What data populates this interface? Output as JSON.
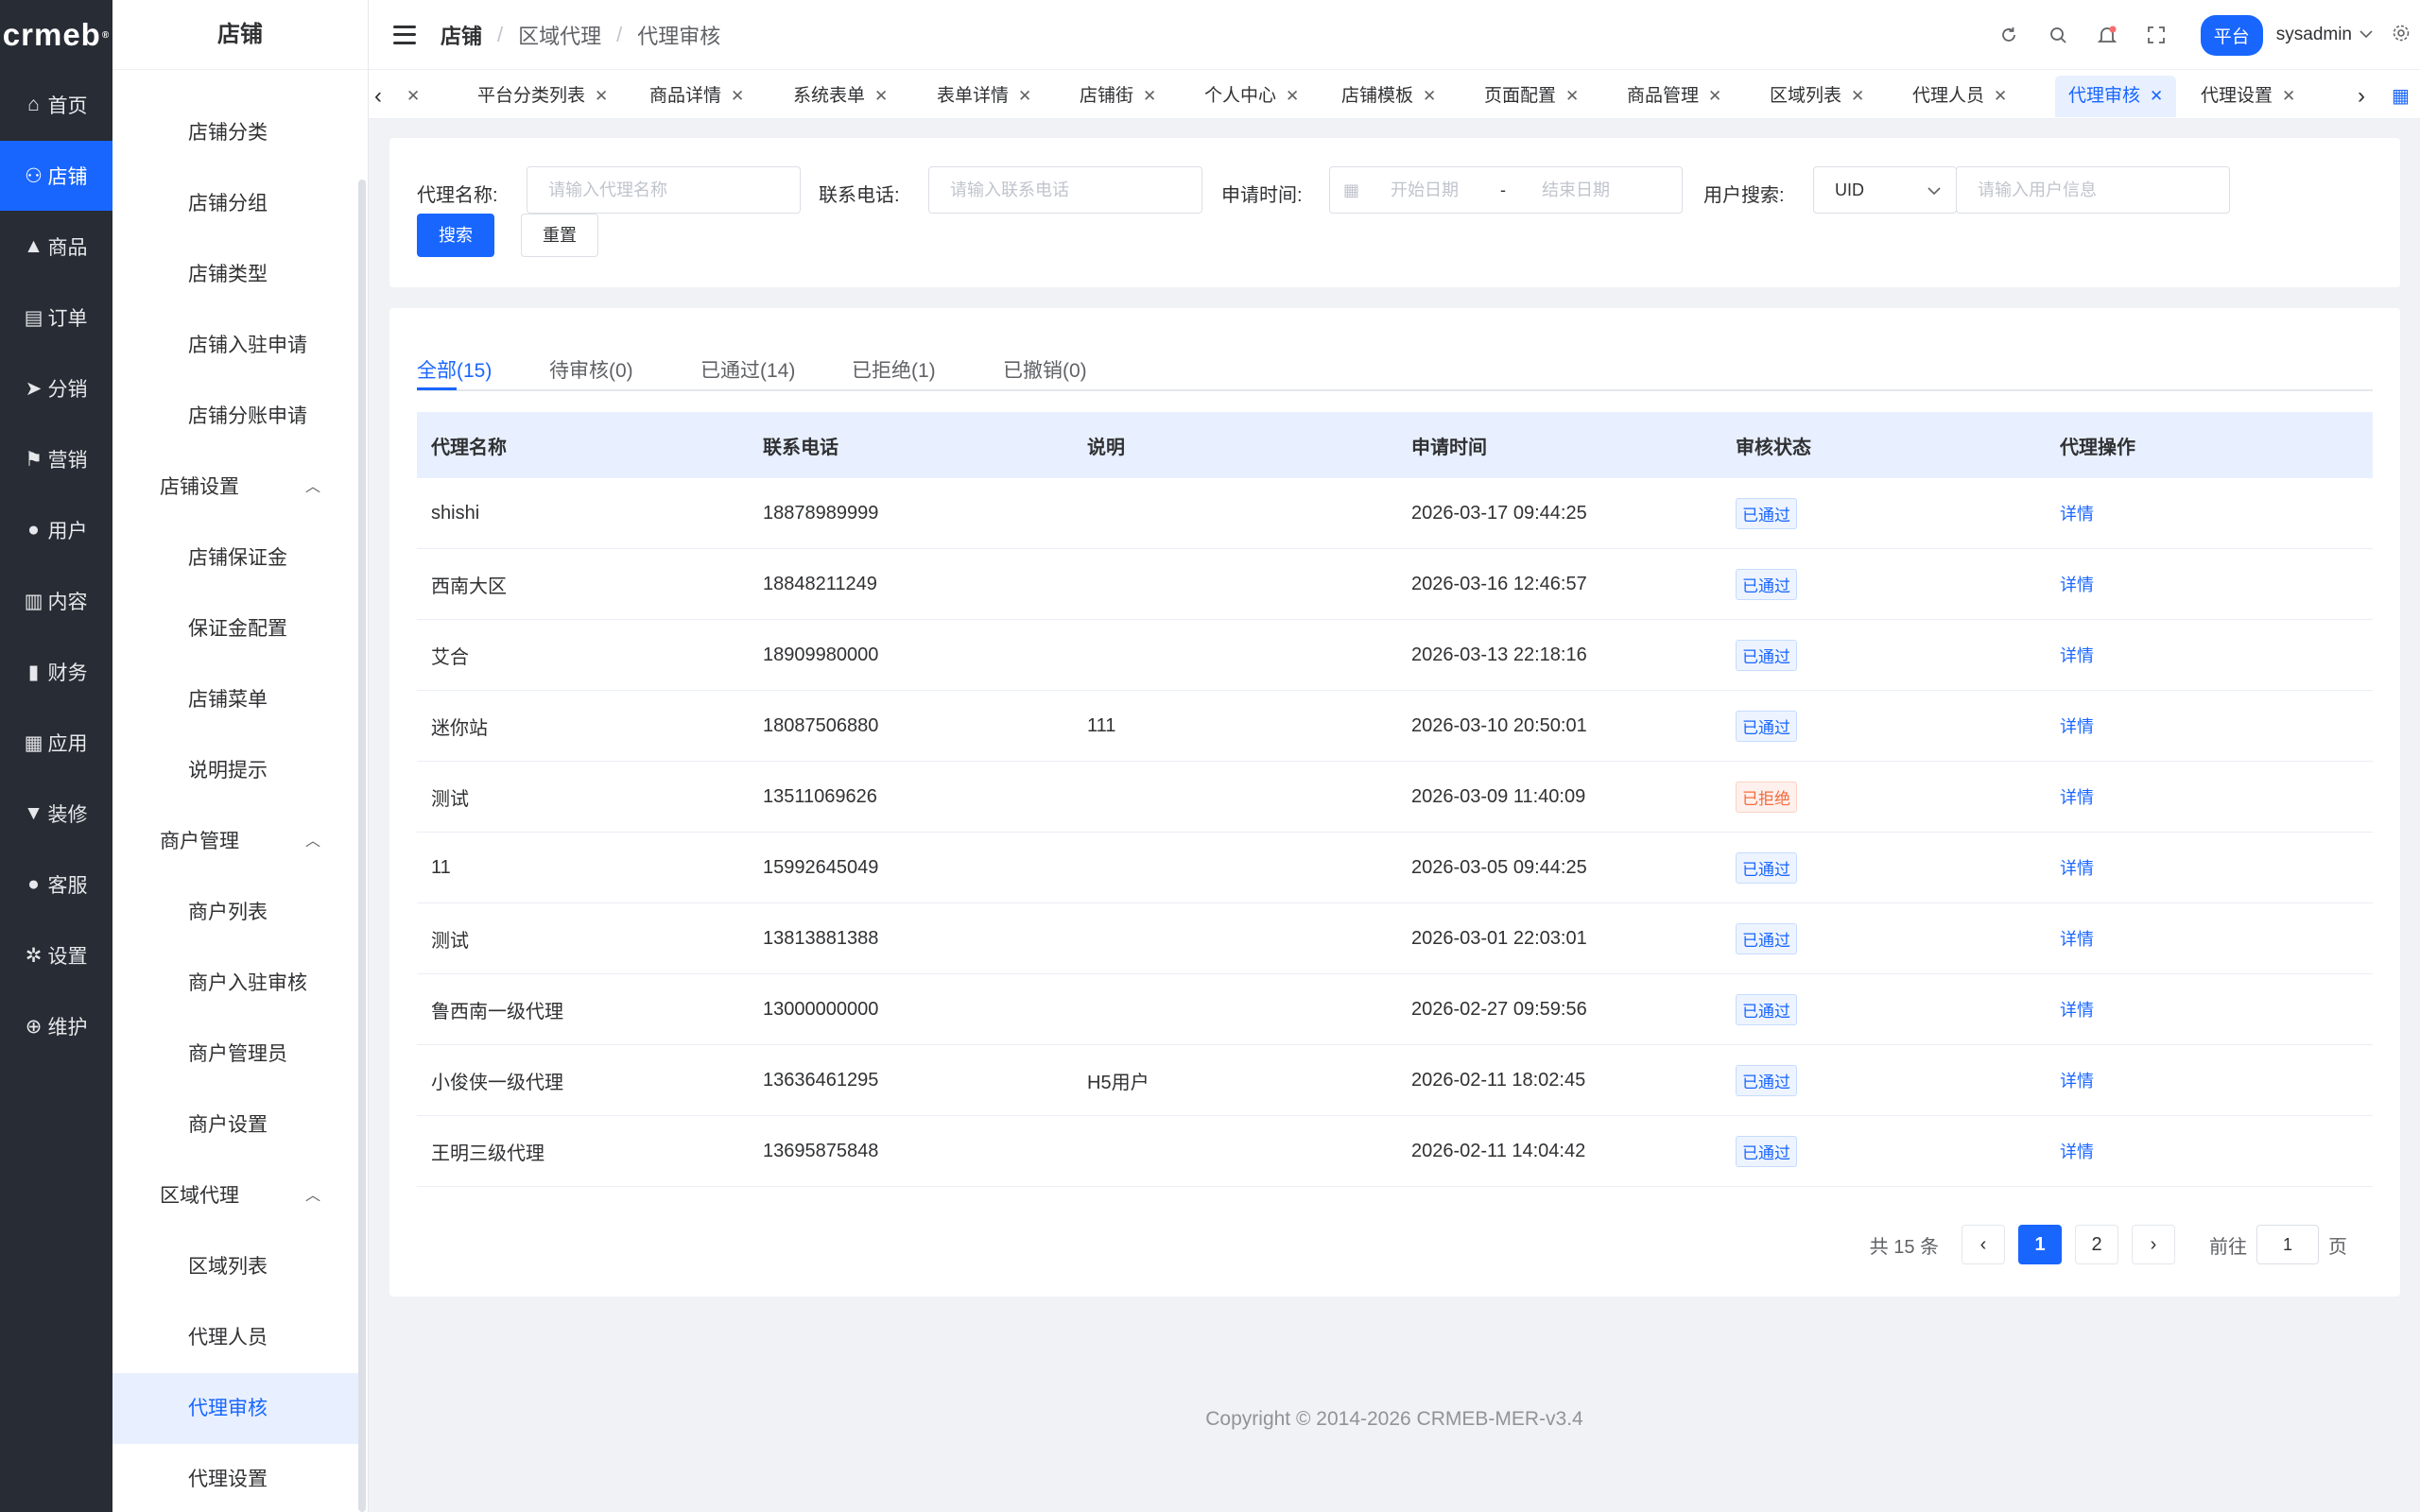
{
  "brand": {
    "logo_text": "crmeb",
    "logo_mark": "®"
  },
  "rail": [
    {
      "label": "首页",
      "icon": "home-icon"
    },
    {
      "label": "店铺",
      "icon": "store-icon",
      "active": true
    },
    {
      "label": "商品",
      "icon": "bag-icon"
    },
    {
      "label": "订单",
      "icon": "order-icon"
    },
    {
      "label": "分销",
      "icon": "send-icon"
    },
    {
      "label": "营销",
      "icon": "flag-icon"
    },
    {
      "label": "用户",
      "icon": "user-icon"
    },
    {
      "label": "内容",
      "icon": "content-icon"
    },
    {
      "label": "财务",
      "icon": "chart-icon"
    },
    {
      "label": "应用",
      "icon": "grid-icon"
    },
    {
      "label": "装修",
      "icon": "brush-icon"
    },
    {
      "label": "客服",
      "icon": "service-icon"
    },
    {
      "label": "设置",
      "icon": "gear-icon"
    },
    {
      "label": "维护",
      "icon": "plus-circle-icon"
    }
  ],
  "sidebar": {
    "title": "店铺",
    "items": [
      {
        "type": "link",
        "label": "店铺分类"
      },
      {
        "type": "link",
        "label": "店铺分组"
      },
      {
        "type": "link",
        "label": "店铺类型"
      },
      {
        "type": "link",
        "label": "店铺入驻申请"
      },
      {
        "type": "link",
        "label": "店铺分账申请"
      },
      {
        "type": "group",
        "label": "店铺设置"
      },
      {
        "type": "link",
        "label": "店铺保证金"
      },
      {
        "type": "link",
        "label": "保证金配置"
      },
      {
        "type": "link",
        "label": "店铺菜单"
      },
      {
        "type": "link",
        "label": "说明提示"
      },
      {
        "type": "group",
        "label": "商户管理"
      },
      {
        "type": "link",
        "label": "商户列表"
      },
      {
        "type": "link",
        "label": "商户入驻审核"
      },
      {
        "type": "link",
        "label": "商户管理员"
      },
      {
        "type": "link",
        "label": "商户设置"
      },
      {
        "type": "group",
        "label": "区域代理"
      },
      {
        "type": "link",
        "label": "区域列表"
      },
      {
        "type": "link",
        "label": "代理人员"
      },
      {
        "type": "link",
        "label": "代理审核",
        "active": true
      },
      {
        "type": "link",
        "label": "代理设置"
      }
    ]
  },
  "header": {
    "breadcrumb": [
      "店铺",
      "区域代理",
      "代理审核"
    ],
    "platform_label": "平台",
    "username": "sysadmin"
  },
  "tabs": {
    "items": [
      {
        "label": "​"
      },
      {
        "label": "平台分类列表"
      },
      {
        "label": "商品详情"
      },
      {
        "label": "系统表单"
      },
      {
        "label": "表单详情"
      },
      {
        "label": "店铺街"
      },
      {
        "label": "个人中心"
      },
      {
        "label": "店铺模板"
      },
      {
        "label": "页面配置"
      },
      {
        "label": "商品管理"
      },
      {
        "label": "区域列表"
      },
      {
        "label": "代理人员"
      },
      {
        "label": "代理审核",
        "active": true
      },
      {
        "label": "代理设置"
      }
    ]
  },
  "search": {
    "agent_name_label": "代理名称:",
    "agent_name_placeholder": "请输入代理名称",
    "phone_label": "联系电话:",
    "phone_placeholder": "请输入联系电话",
    "time_label": "申请时间:",
    "start_placeholder": "开始日期",
    "range_sep": "-",
    "end_placeholder": "结束日期",
    "user_label": "用户搜索:",
    "user_type": "UID",
    "user_placeholder": "请输入用户信息",
    "search_btn": "搜索",
    "reset_btn": "重置"
  },
  "status_tabs": [
    {
      "label": "全部(15)",
      "active": true
    },
    {
      "label": "待审核(0)"
    },
    {
      "label": "已通过(14)"
    },
    {
      "label": "已拒绝(1)"
    },
    {
      "label": "已撤销(0)"
    }
  ],
  "table": {
    "columns": [
      "代理名称",
      "联系电话",
      "说明",
      "申请时间",
      "审核状态",
      "代理操作"
    ],
    "rows": [
      {
        "name": "shishi",
        "phone": "18878989999",
        "note": "",
        "time": "2026-03-17 09:44:25",
        "status": "已通过",
        "action": "详情"
      },
      {
        "name": "西南大区",
        "phone": "18848211249",
        "note": "",
        "time": "2026-03-16 12:46:57",
        "status": "已通过",
        "action": "详情"
      },
      {
        "name": "艾合",
        "phone": "18909980000",
        "note": "",
        "time": "2026-03-13 22:18:16",
        "status": "已通过",
        "action": "详情"
      },
      {
        "name": "迷你站",
        "phone": "18087506880",
        "note": "111",
        "time": "2026-03-10 20:50:01",
        "status": "已通过",
        "action": "详情"
      },
      {
        "name": "测试",
        "phone": "13511069626",
        "note": "",
        "time": "2026-03-09 11:40:09",
        "status": "已拒绝",
        "action": "详情",
        "rejected": true
      },
      {
        "name": "11",
        "phone": "15992645049",
        "note": "",
        "time": "2026-03-05 09:44:25",
        "status": "已通过",
        "action": "详情"
      },
      {
        "name": "测试",
        "phone": "13813881388",
        "note": "",
        "time": "2026-03-01 22:03:01",
        "status": "已通过",
        "action": "详情"
      },
      {
        "name": "鲁西南一级代理",
        "phone": "13000000000",
        "note": "",
        "time": "2026-02-27 09:59:56",
        "status": "已通过",
        "action": "详情"
      },
      {
        "name": "小俊侠一级代理",
        "phone": "13636461295",
        "note": "H5用户",
        "time": "2026-02-11 18:02:45",
        "status": "已通过",
        "action": "详情"
      },
      {
        "name": "王明三级代理",
        "phone": "13695875848",
        "note": "",
        "time": "2026-02-11 14:04:42",
        "status": "已通过",
        "action": "详情"
      }
    ]
  },
  "pagination": {
    "total_text": "共 15 条",
    "pages": [
      "1",
      "2"
    ],
    "current": "1",
    "goto_label": "前往",
    "goto_value": "1",
    "page_suffix": "页"
  },
  "footer": {
    "copyright": "Copyright © 2014-2026 CRMEB-MER-v3.4"
  },
  "colors": {
    "primary": "#1966ff",
    "rail_bg": "#282c34",
    "reject": "#f56c3c"
  }
}
